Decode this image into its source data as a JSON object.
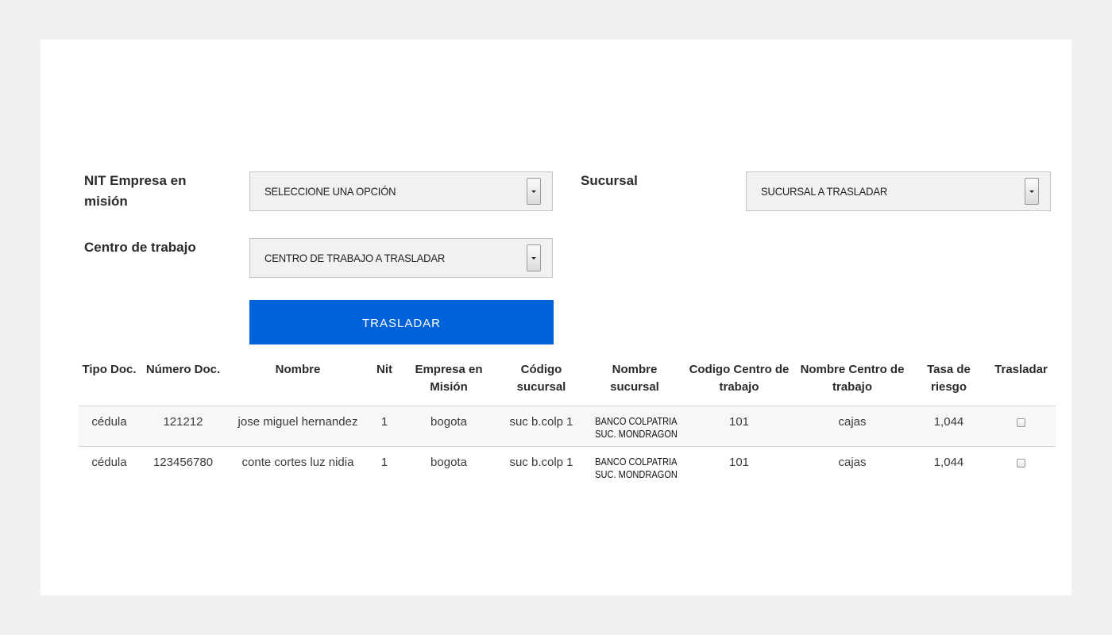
{
  "form": {
    "nit_label": "NIT Empresa en misión",
    "nit_select_value": "SELECCIONE UNA OPCIÓN",
    "sucursal_label": "Sucursal",
    "sucursal_select_value": "SUCURSAL A TRASLADAR",
    "centro_label": "Centro de trabajo",
    "centro_select_value": "CENTRO DE TRABAJO A TRASLADAR",
    "submit_label": "TRASLADAR"
  },
  "table": {
    "headers": [
      "Tipo Doc.",
      "Número Doc.",
      "Nombre",
      "Nit",
      "Empresa en Misión",
      "Código sucursal",
      "Nombre sucursal",
      "Codigo Centro de trabajo",
      "Nombre Centro de trabajo",
      "Tasa de riesgo",
      "Trasladar"
    ],
    "rows": [
      {
        "tipo_doc": "cédula",
        "numero_doc": "121212",
        "nombre": "jose miguel hernandez",
        "nit": "1",
        "empresa": "bogota",
        "codigo_sucursal": "suc b.colp 1",
        "nombre_sucursal_line1": "BANCO COLPATRIA",
        "nombre_sucursal_line2": "SUC. MONDRAGON",
        "codigo_centro": "101",
        "nombre_centro": "cajas",
        "tasa_riesgo": "1,044",
        "trasladar": false
      },
      {
        "tipo_doc": "cédula",
        "numero_doc": "123456780",
        "nombre": "conte cortes luz nidia",
        "nit": "1",
        "empresa": "bogota",
        "codigo_sucursal": "suc b.colp 1",
        "nombre_sucursal_line1": "BANCO COLPATRIA",
        "nombre_sucursal_line2": "SUC. MONDRAGON",
        "codigo_centro": "101",
        "nombre_centro": "cajas",
        "tasa_riesgo": "1,044",
        "trasladar": false
      }
    ]
  },
  "colors": {
    "page_background": "#f0f0f0",
    "card_background": "#ffffff",
    "accent_button": "#0062d8",
    "select_background": "#f1f1f1",
    "striped_row": "#f7f7f7"
  },
  "icons": {
    "select_arrow": "chevron-down-icon",
    "row_checkbox": "checkbox-icon"
  }
}
